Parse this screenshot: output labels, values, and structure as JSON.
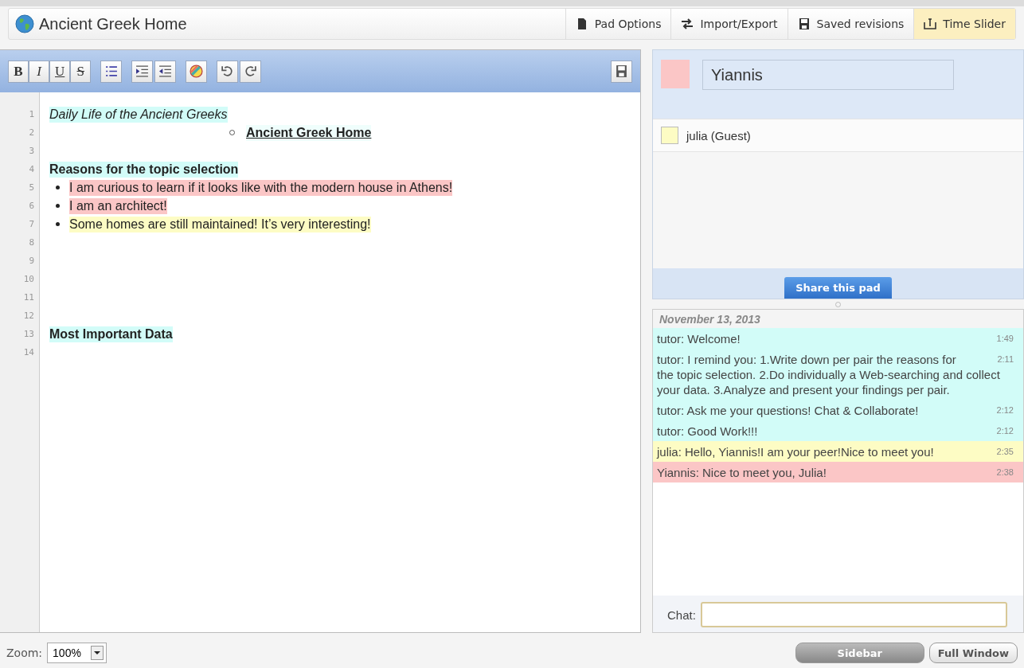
{
  "topbar": {
    "title": "Ancient Greek Home",
    "menu": [
      {
        "label": "Pad Options",
        "selected": false
      },
      {
        "label": "Import/Export",
        "selected": false
      },
      {
        "label": "Saved revisions",
        "selected": false
      },
      {
        "label": "Time Slider",
        "selected": true
      }
    ]
  },
  "toolbar": {
    "format": [
      {
        "label": "B",
        "kind": "bold"
      },
      {
        "label": "I",
        "kind": "italic"
      },
      {
        "label": "U",
        "kind": "underline"
      },
      {
        "label": "S",
        "kind": "strike"
      }
    ]
  },
  "editor": {
    "lines": [
      {
        "number": "1",
        "kind": "italic",
        "text": "Daily Life of the Ancient Greeks",
        "color": "#d2fcf8"
      },
      {
        "number": "2",
        "kind": "sublink",
        "text": "Ancient Greek Home",
        "color": "#effefc"
      },
      {
        "number": "3",
        "kind": "empty"
      },
      {
        "number": "4",
        "kind": "heading",
        "text": "Reasons for the topic selection",
        "color": "#d2fcf8"
      },
      {
        "number": "5",
        "kind": "bullet",
        "text": "I am curious to learn if it looks like with the modern house in Athens!",
        "color": "#fbc6c6"
      },
      {
        "number": "6",
        "kind": "bullet",
        "text": "I am an architect!",
        "color": "#fbc6c6"
      },
      {
        "number": "7",
        "kind": "bullet",
        "text": "Some homes are still maintained! It’s very interesting!",
        "color": "#fdfcc4"
      },
      {
        "number": "8",
        "kind": "empty"
      },
      {
        "number": "9",
        "kind": "empty"
      },
      {
        "number": "10",
        "kind": "empty"
      },
      {
        "number": "11",
        "kind": "empty"
      },
      {
        "number": "12",
        "kind": "empty"
      },
      {
        "number": "13",
        "kind": "heading",
        "text": "Most Important Data",
        "color": "#d2fcf8"
      },
      {
        "number": "14",
        "kind": "empty"
      }
    ]
  },
  "users": {
    "me": {
      "name": "Yiannis",
      "color": "#fbc6c6"
    },
    "others": [
      {
        "name": "julia (Guest)",
        "color": "#fdfcc4"
      }
    ],
    "share_button": "Share this pad"
  },
  "chat": {
    "date": "November 13, 2013",
    "messages": [
      {
        "text": "tutor: Welcome!",
        "time": "1:49",
        "color": "#d2fcf8"
      },
      {
        "text": "tutor: I remind you: 1.Write down per pair the reasons for the topic selection. 2.Do individually a Web-searching and collect your data. 3.Analyze and present your findings per pair.",
        "time": "2:11",
        "color": "#d2fcf8"
      },
      {
        "text": "tutor: Ask me your questions! Chat & Collaborate!",
        "time": "2:12",
        "color": "#d2fcf8"
      },
      {
        "text": "tutor: Good Work!!!",
        "time": "2:12",
        "color": "#d2fcf8"
      },
      {
        "text": "julia: Hello, Yiannis!I am your peer!Nice to meet you!",
        "time": "2:35",
        "color": "#fdfcc4"
      },
      {
        "text": "Yiannis: Nice to meet you, Julia!",
        "time": "2:38",
        "color": "#fbc6c6"
      }
    ],
    "input_label": "Chat:"
  },
  "footer": {
    "zoom_label": "Zoom:",
    "zoom_value": "100%",
    "buttons": [
      {
        "label": "Sidebar",
        "selected": true
      },
      {
        "label": "Full Window",
        "selected": false
      }
    ]
  }
}
